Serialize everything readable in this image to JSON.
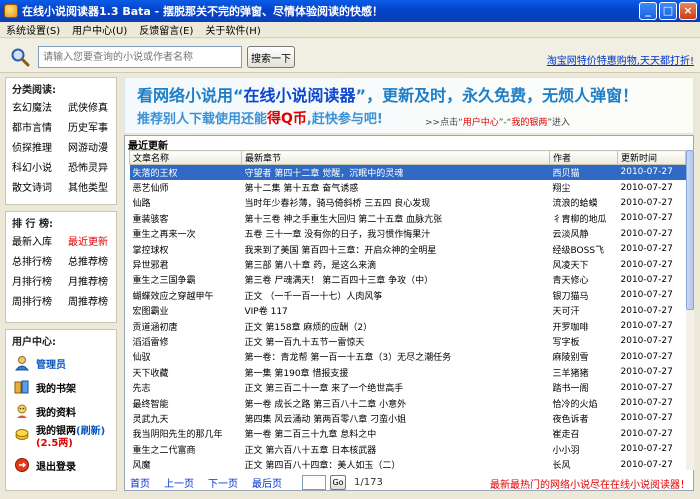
{
  "window": {
    "title": "在线小说阅读器1.3 Bata  - 摆脱那关不完的弹窗、尽情体验阅读的快感！",
    "minimize": "_",
    "maximize": "□",
    "close": "×"
  },
  "menu": [
    "系统设置(S)",
    "用户中心(U)",
    "反馈留言(E)",
    "关于软件(H)"
  ],
  "search": {
    "placeholder": "请输入您要查询的小说或作者名称",
    "button": "搜索一下",
    "promo_link": "淘宝网特价特惠购物,天天都打折!"
  },
  "sidebar": {
    "categories": {
      "title": "分类阅读:",
      "items": [
        "玄幻魔法",
        "武侠修真",
        "都市言情",
        "历史军事",
        "侦探推理",
        "网游动漫",
        "科幻小说",
        "恐怖灵异",
        "散文诗词",
        "其他类型"
      ]
    },
    "rankings": {
      "title": "排 行 榜:",
      "items": [
        "最新入库",
        "最近更新",
        "总排行榜",
        "总推荐榜",
        "月排行榜",
        "月推荐榜",
        "周排行榜",
        "周推荐榜"
      ],
      "highlight": "最近更新"
    },
    "user_center": {
      "title": "用户中心:",
      "admin": "管理员",
      "bookshelf": "我的书架",
      "profile": "我的资料",
      "points_label": "我的银两",
      "points_refresh": "(刷新)",
      "points_value": "(2.5两)",
      "logout": "退出登录"
    }
  },
  "banner": {
    "line1_a": "看网络小说用“",
    "line1_b": "在线小说阅读器",
    "line1_c": "”，更新及时，永久免费，无烦人弹窗！",
    "line2_a": "推荐别人下载使用还能",
    "line2_b": "得Q币",
    "line2_c": ",赶快参与吧!",
    "hint_a": ">>点击“",
    "hint_b": "用户中心",
    "hint_c": "”-“",
    "hint_d": "我的银两",
    "hint_e": "”进入"
  },
  "list": {
    "title": "最近更新",
    "columns": [
      "文章名称",
      "最新章节",
      "作者",
      "更新时间"
    ],
    "rows": [
      [
        "失落的王权",
        "守望者  第四十二章 觉醒，沉眠中的灵魂",
        "西贝猫",
        "2010-07-27"
      ],
      [
        "恶艺仙师",
        "第十二集 第十五章 奋气诱惑",
        "翔尘",
        "2010-07-27"
      ],
      [
        "仙路",
        "当时年少春衫薄，骑马倚斜桥 三五四 良心发现",
        "流浪的蛤蟆",
        "2010-07-27"
      ],
      [
        "重装骇客",
        "第十三卷 神之手重生大回归 第二十五章 血脉亢张",
        "彳胄柳的地瓜",
        "2010-07-27"
      ],
      [
        "重生之再来一次",
        "五卷 三十一章 没有你的日子，我习惯作悔果汁",
        "云淡风静",
        "2010-07-27"
      ],
      [
        "掌控球权",
        "我来到了美国 第百四十三章：开启众神的全明星",
        "经级BOSS飞",
        "2010-07-27"
      ],
      [
        "异世邪君",
        "第三部 第八十章 药，是这么来滴",
        "风凌天下",
        "2010-07-27"
      ],
      [
        "重生之三国争霸",
        "第三卷 尸魂满天！ 第二百四十三章 争攻（中）",
        "青天修心",
        "2010-07-27"
      ],
      [
        "蝴蝶效应之穿越甲午",
        "正文 （一千一百一十七）人肉风筝",
        "银刀猫马",
        "2010-07-27"
      ],
      [
        "宏图霸业",
        "VIP卷 117",
        "天可汗",
        "2010-07-27"
      ],
      [
        "贡道涵初唐",
        "正文 第158章 麻烦的应酬（2）",
        "开罗咖啡",
        "2010-07-27"
      ],
      [
        "滔滔雷修",
        "正文 第一百九十五节一雷惊天",
        "写字板",
        "2010-07-27"
      ],
      [
        "仙驭",
        "第一卷：青龙帮 第一百一十五章（3）无尽之潮任务",
        "麻陵别雪",
        "2010-07-27"
      ],
      [
        "天下收藏",
        "第一集 第190章 惜报支援",
        "三羊猪猪",
        "2010-07-27"
      ],
      [
        "先志",
        "正文 第三百二十一章 来了一个绝世高手",
        "踏书一阁",
        "2010-07-27"
      ],
      [
        "最终智能",
        "第一卷 成长之路 第三百八十二章 小意外",
        "恰冷的火焰",
        "2010-07-27"
      ],
      [
        "灵武九天",
        "第四集 风云涌动 第两百零八章 刁蛮小姐",
        "夜色诉者",
        "2010-07-27"
      ],
      [
        "我当阴阳先生的那几年",
        "第一卷 第二百三十九章 怠料之中",
        "崔走召",
        "2010-07-27"
      ],
      [
        "重生之二代富商",
        "正文 第六百八十五章 日本核武器",
        "小小羽",
        "2010-07-27"
      ],
      [
        "风魔",
        "正文 第四百八十四章：美人如玉（二）",
        "长风",
        "2010-07-27"
      ]
    ]
  },
  "pager": {
    "first": "首页",
    "prev": "上一页",
    "next": "下一页",
    "last": "最后页",
    "go": "Go",
    "info": "1/173"
  },
  "footer": "最新最热门的网络小说尽在在线小说阅读器！",
  "colors": {
    "selection": "#316ac5",
    "accent_red": "#e00000",
    "link_blue": "#0033cc"
  }
}
